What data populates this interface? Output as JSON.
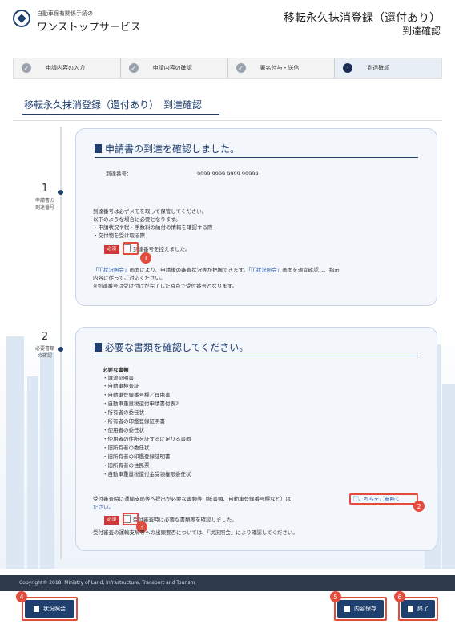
{
  "header": {
    "logo_sub": "自動車保有関係手続の",
    "logo_main": "ワンストップサービス",
    "title": "移転永久抹消登録（還付あり）",
    "subtitle": "到達確認"
  },
  "steps": [
    {
      "label": "申請内容の入力"
    },
    {
      "label": "申請内容の確認"
    },
    {
      "label": "署名付与・送信"
    },
    {
      "label": "到達確認"
    }
  ],
  "section_tab": "移転永久抹消登録（還付あり）　到達確認",
  "timeline": [
    {
      "num": "1",
      "label_line1": "申請書の",
      "label_line2": "到達番号"
    },
    {
      "num": "2",
      "label_line1": "必要書類",
      "label_line2": "の確認"
    }
  ],
  "card1": {
    "title": "申請書の到達を確認しました。",
    "arrival_label": "到達番号：",
    "arrival_value": "9999 9999 9999 99999",
    "note1": "到達番号は必ずメモを取って保管してください。",
    "note2": "以下のような場合に必要となります。",
    "note3": "・申請状況や税・手数料の納付の情報を確認する際",
    "note4": "・交付物を受け取る際",
    "required_badge": "必須",
    "checkbox_label": "到達番号を控えました。",
    "info1_link_a": "「🄸状況照会」",
    "info1_text_a": "画面により、申請後の審査状況等が把握できます。",
    "info1_link_b": "「🄸状況照会」",
    "info1_text_b": "画面を適宜確認し、指示",
    "info2": "内容に従ってご対応ください。",
    "info3": "※到達番号は受け付けが完了した時点で受付番号となります。"
  },
  "card2": {
    "title": "必要な書類を確認してください。",
    "docs_heading": "必要な書類",
    "docs": [
      "・譲渡証明書",
      "・自動車検査証",
      "・自動車登録番号標／理由書",
      "・自動車重量税還付申請書付表2",
      "・所有者の委任状",
      "・所有者の印鑑登録証明書",
      "・使用者の委任状",
      "・使用者の住所を証するに足りる書面",
      "・旧所有者の委任状",
      "・旧所有者の印鑑登録証明書",
      "・旧所有者の住民票",
      "・自動車重量税還付金受領権限委任状"
    ],
    "note_a": "受付審査時に運輸支局等へ提出が必要な書類等（紙書類、自動車登録番号標など）は",
    "note_link": "🄸こちらをご参照く",
    "note_link2": "ださい。",
    "required_badge": "必須",
    "checkbox_label": "受付審査時に必要な書類等を確認しました。",
    "note_b": "受付審査の運輸支局等への出頭要否については、「状況照会」により確認してください。"
  },
  "markers": [
    "1",
    "2",
    "3",
    "4",
    "5",
    "6"
  ],
  "footer": {
    "copyright": "Copyright© 2018, Ministry of Land, Infrastructure, Transport and Tourism"
  },
  "buttons": {
    "status": "状況照会",
    "save": "内容保存",
    "end": "終了"
  },
  "colors": {
    "brand": "#1f3f6f",
    "highlight": "#e34b3d",
    "required": "#d0393b"
  }
}
